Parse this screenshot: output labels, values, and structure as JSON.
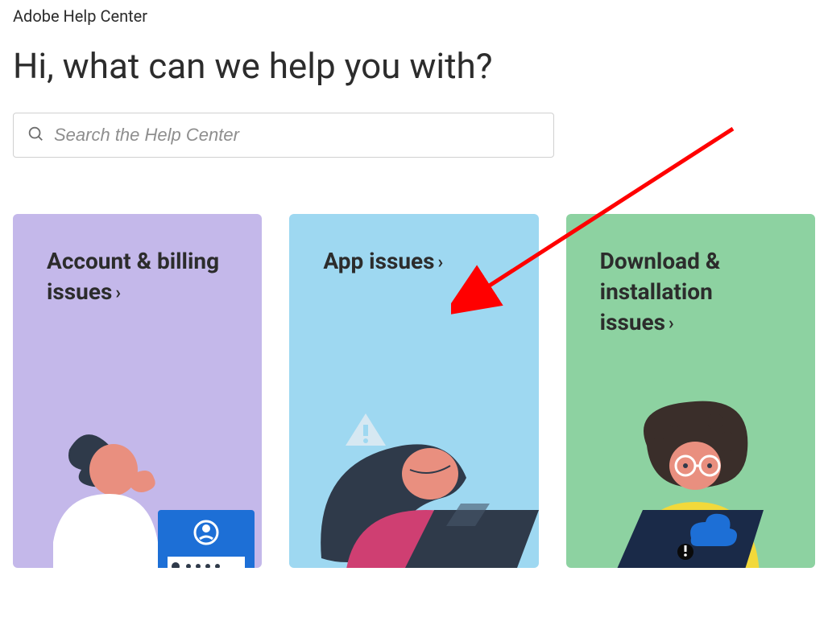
{
  "header": {
    "title": "Adobe Help Center"
  },
  "heading": "Hi, what can we help you with?",
  "search": {
    "placeholder": "Search the Help Center",
    "value": ""
  },
  "cards": [
    {
      "title": "Account & billing issues",
      "color": "purple"
    },
    {
      "title": "App issues",
      "color": "blue"
    },
    {
      "title": "Download & installation issues",
      "color": "green"
    }
  ],
  "annotation": {
    "type": "arrow",
    "color": "#ff0000",
    "target": "card-app-issues"
  }
}
